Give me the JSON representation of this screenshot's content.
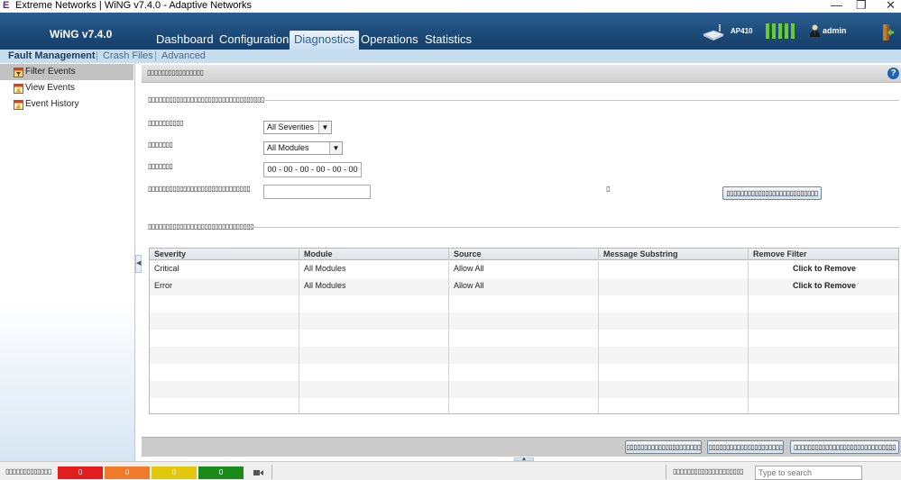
{
  "window": {
    "title": "Extreme Networks | WiNG v7.4.0 - Adaptive Networks",
    "app_icon_glyph": "E",
    "minimize_glyph": "—",
    "restore_glyph": "❐",
    "close_glyph": "✕"
  },
  "header": {
    "product": "WiNG v7.4.0",
    "tabs": [
      {
        "label": "Dashboard",
        "active": false
      },
      {
        "label": "Configuration",
        "active": false
      },
      {
        "label": "Diagnostics",
        "active": true
      },
      {
        "label": "Operations",
        "active": false
      },
      {
        "label": "Statistics",
        "active": false
      }
    ],
    "device_label": "AP410",
    "user_label": "admin",
    "health_color": "#6acd2f"
  },
  "subnav": {
    "tabs": [
      {
        "label": "Fault Management",
        "active": true
      },
      {
        "label": "Crash Files",
        "active": false
      },
      {
        "label": "Advanced",
        "active": false
      }
    ],
    "separator": "|"
  },
  "sidebar": {
    "items": [
      {
        "label": "Filter Events",
        "active": true,
        "icon": "filter-events-icon"
      },
      {
        "label": "View Events",
        "active": false,
        "icon": "view-events-icon"
      },
      {
        "label": "Event History",
        "active": false,
        "icon": "event-history-icon"
      }
    ],
    "collapse_glyph": "◀"
  },
  "main": {
    "title": "▯▯▯▯▯▯▯▯▯▯▯▯▯▯▯▯",
    "help_glyph": "?",
    "filter_section_label": "▯▯▯▯▯▯▯▯▯▯▯▯▯▯▯▯▯▯▯▯▯▯▯▯▯▯▯▯▯▯▯▯▯",
    "severity_label": "▯▯▯▯▯▯▯▯▯▯",
    "module_label": "▯▯▯▯▯▯▯",
    "source_label": "▯▯▯▯▯▯▯",
    "substring_label": "▯▯▯▯▯▯▯▯▯▯▯▯▯▯▯▯▯▯▯▯▯▯▯▯▯▯▯▯▯",
    "severity_value": "All Severities",
    "module_value": "All Modules",
    "mac_value": "00 - 00 - 00 - 00 - 00 - 00",
    "substring_value": "",
    "small_glyph": "▯",
    "add_button_label": "▯▯▯▯▯▯▯▯▯▯▯▯▯▯▯▯▯▯▯▯▯▯▯▯▯▯",
    "active_section_label": "▯▯▯▯▯▯▯▯▯▯▯▯▯▯▯▯▯▯▯▯▯▯▯▯▯▯▯▯▯▯"
  },
  "table": {
    "columns": [
      "Severity",
      "Module",
      "Source",
      "Message Substring",
      "Remove Filter"
    ],
    "rows": [
      {
        "severity": "Critical",
        "module": "All Modules",
        "source": "Allow All",
        "substring": "",
        "action": "Click to Remove"
      },
      {
        "severity": "Error",
        "module": "All Modules",
        "source": "Allow All",
        "substring": "",
        "action": "Click to Remove"
      }
    ]
  },
  "footer": {
    "buttons": [
      "▯▯▯▯▯▯▯▯▯▯▯▯▯▯▯▯▯▯▯▯▯",
      "▯▯▯▯▯▯▯▯▯▯▯▯▯▯▯▯▯▯▯▯▯",
      "▯▯▯▯▯▯▯▯▯▯▯▯▯▯▯▯▯▯▯▯▯▯▯▯▯▯▯▯▯"
    ],
    "scroll_glyph": "▲"
  },
  "statusbar": {
    "label": "▯▯▯▯▯▯▯▯▯▯▯▯▯",
    "alarms": [
      {
        "count": "0",
        "color": "#e11d1d"
      },
      {
        "count": "0",
        "color": "#f07a2a"
      },
      {
        "count": "0",
        "color": "#e3c70d"
      },
      {
        "count": "0",
        "color": "#1a8a1a"
      }
    ],
    "camera_glyph": "▶",
    "search_label": "▯▯▯▯▯▯▯▯▯▯▯▯▯▯▯▯▯▯▯▯",
    "search_placeholder": "Type to search"
  }
}
